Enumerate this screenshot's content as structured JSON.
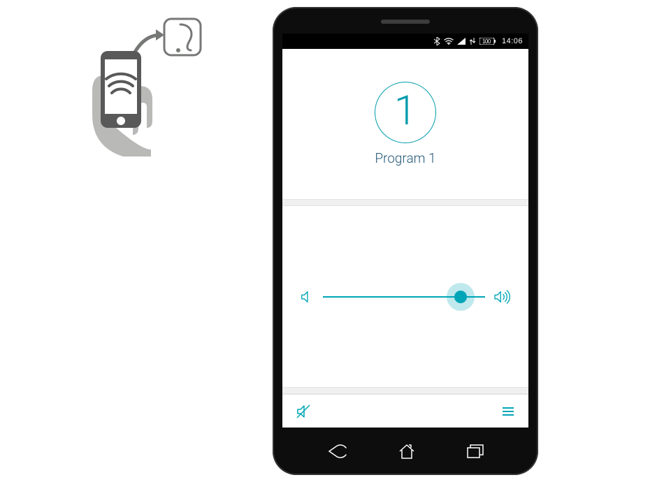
{
  "status_bar": {
    "battery_level": "100",
    "time": "14:06"
  },
  "program": {
    "number": "1",
    "label": "Program 1"
  },
  "volume": {
    "percent": 85
  },
  "colors": {
    "teal": "#00a6b7",
    "dark_teal": "#275a78",
    "gray": "#767876"
  },
  "icons": {
    "bluetooth": "bluetooth-icon",
    "wifi": "wifi-icon",
    "signal": "signal-icon",
    "battery": "battery-icon",
    "vol_low": "volume-low-icon",
    "vol_high": "volume-high-icon",
    "mute": "mute-icon",
    "menu": "menu-icon",
    "back": "back-icon",
    "home": "home-icon",
    "recents": "recents-icon",
    "hearing_aid": "hearing-aid-icon",
    "hand_phone": "phone-in-hand-icon"
  }
}
